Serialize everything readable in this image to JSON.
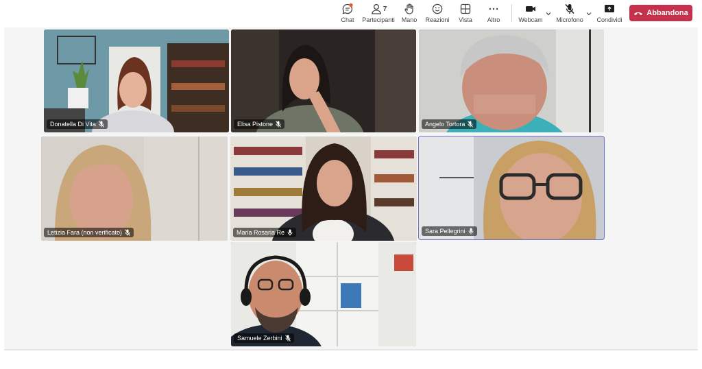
{
  "toolbar": {
    "chat": "Chat",
    "participants": "Partecipanti",
    "participants_count": "7",
    "hand": "Mano",
    "reactions": "Reazioni",
    "view": "Vista",
    "more": "Altro",
    "webcam": "Webcam",
    "mic": "Microfono",
    "share": "Condividi",
    "leave": "Abbandona"
  },
  "colors": {
    "leave": "#c4314b",
    "active_border": "#6c70c8",
    "chat_badge": "#e8582c"
  },
  "participants": [
    {
      "name": "Donatella Di Vita"
    },
    {
      "name": "Elisa Pistone"
    },
    {
      "name": "Angelo Tortora"
    },
    {
      "name": "Letizia Fara (non verificato)"
    },
    {
      "name": "Maria Rosaria Re"
    },
    {
      "name": "Sara Pellegrini"
    },
    {
      "name": "Samuele Zerbini"
    }
  ]
}
